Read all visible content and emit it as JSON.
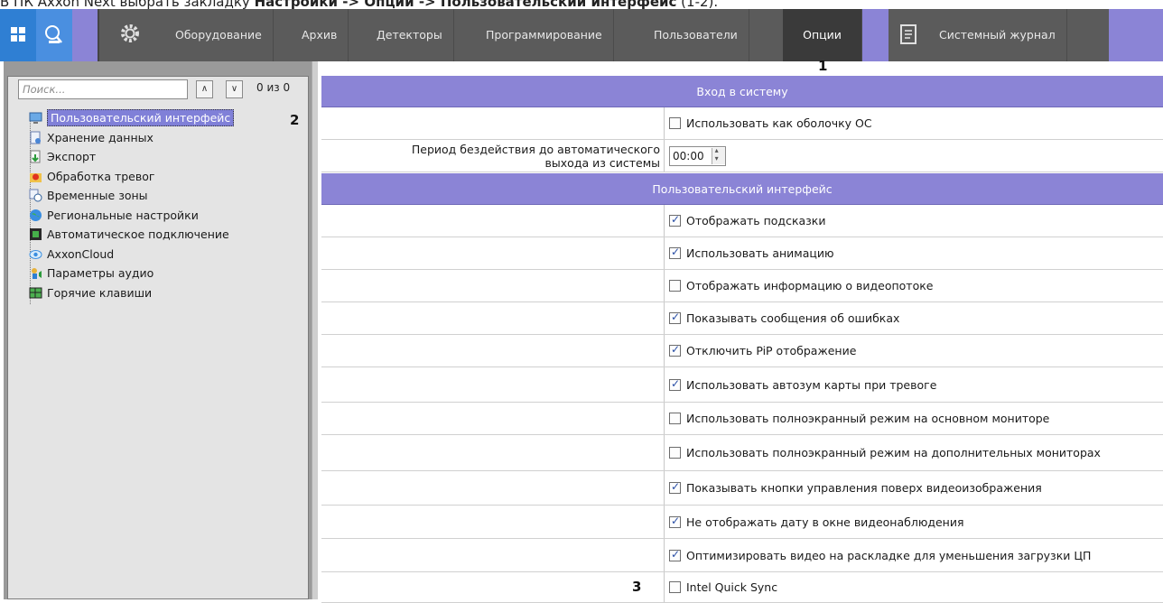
{
  "caption": {
    "prefix": "В ПК Axxon Next выбрать закладку ",
    "p1": "Настройки",
    "arrow1": " -> ",
    "p2": "Опции",
    "arrow2": " -> ",
    "p3": "Пользовательский интерфейс",
    "suffix": " (1-2)."
  },
  "topbar": {
    "tabs": [
      "Оборудование",
      "Архив",
      "Детекторы",
      "Программирование",
      "Пользователи",
      "Опции",
      "Системный журнал"
    ],
    "active_tab": "Опции"
  },
  "callouts": {
    "c1": "1",
    "c2": "2",
    "c3": "3"
  },
  "sidebar": {
    "search_placeholder": "Поиск...",
    "counter": "0 из 0",
    "items": [
      {
        "label": "Пользовательский интерфейс",
        "icon": "monitor-icon",
        "selected": true
      },
      {
        "label": "Хранение данных",
        "icon": "storage-icon"
      },
      {
        "label": "Экспорт",
        "icon": "export-icon"
      },
      {
        "label": "Обработка тревог",
        "icon": "alarm-icon"
      },
      {
        "label": "Временные зоны",
        "icon": "timezone-icon"
      },
      {
        "label": "Региональные настройки",
        "icon": "globe-icon"
      },
      {
        "label": "Автоматическое подключение",
        "icon": "autoconnect-icon"
      },
      {
        "label": "AxxonCloud",
        "icon": "cloud-icon"
      },
      {
        "label": "Параметры аудио",
        "icon": "audio-icon"
      },
      {
        "label": "Горячие клавиши",
        "icon": "keyboard-icon"
      }
    ]
  },
  "main": {
    "section_login": "Вход в систему",
    "os_shell": {
      "label": "Использовать как оболочку ОС",
      "checked": false
    },
    "idle_period": {
      "label_line1": "Период бездействия до автоматического",
      "label_line2": "выхода из системы",
      "value": "00:00"
    },
    "section_ui": "Пользовательский интерфейс",
    "options": [
      {
        "label": "Отображать подсказки",
        "checked": true
      },
      {
        "label": "Использовать анимацию",
        "checked": true
      },
      {
        "label": "Отображать информацию о видеопотоке",
        "checked": false
      },
      {
        "label": "Показывать сообщения об ошибках",
        "checked": true
      },
      {
        "label": "Отключить PiP отображение",
        "checked": true
      },
      {
        "label": "Использовать автозум карты при тревоге",
        "checked": true
      },
      {
        "label": "Использовать полноэкранный режим на основном мониторе",
        "checked": false
      },
      {
        "label": "Использовать полноэкранный режим на дополнительных мониторах",
        "checked": false
      },
      {
        "label": "Показывать кнопки управления поверх видеоизображения",
        "checked": true
      },
      {
        "label": "Не отображать дату в окне видеонаблюдения",
        "checked": true
      },
      {
        "label": "Оптимизировать видео на раскладке для уменьшения загрузки ЦП",
        "checked": true
      },
      {
        "label": "Intel Quick Sync",
        "checked": false
      }
    ]
  },
  "colors": {
    "accent": "#8b84d6",
    "topbar": "#5b5b5b",
    "active_tab": "#3a3a3a",
    "selected_item": "#8080d8"
  }
}
